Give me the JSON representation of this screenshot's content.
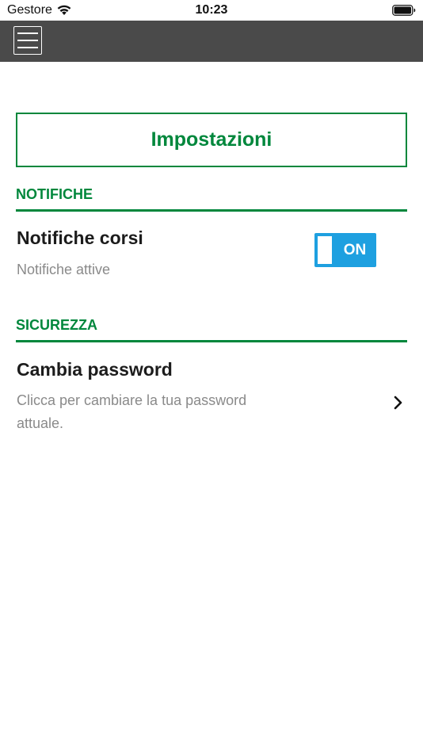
{
  "status_bar": {
    "carrier": "Gestore",
    "time": "10:23"
  },
  "nav": {
    "menu_icon": "hamburger-icon"
  },
  "page": {
    "title": "Impostazioni"
  },
  "sections": {
    "notifications": {
      "header": "NOTIFICHE",
      "item_title": "Notifiche corsi",
      "item_subtitle": "Notifiche attive",
      "toggle_label": "ON"
    },
    "security": {
      "header": "SICUREZZA",
      "item_title": "Cambia password",
      "item_subtitle_line1": "Clicca per cambiare la tua password",
      "item_subtitle_line2": "attuale."
    }
  },
  "colors": {
    "accent": "#00873c",
    "navbar": "#4a4a4a",
    "toggle_on": "#1ea0e0",
    "subtitle": "#8a8a8a"
  }
}
